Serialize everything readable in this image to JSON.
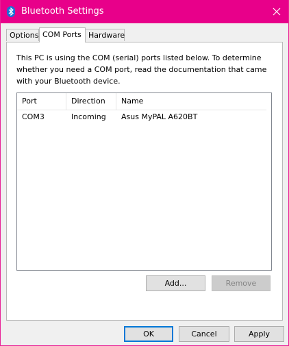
{
  "window": {
    "title": "Bluetooth Settings",
    "title_icon": "bluetooth-icon",
    "close_icon": "close-icon"
  },
  "tabs": [
    {
      "label": "Options",
      "active": false
    },
    {
      "label": "COM Ports",
      "active": true
    },
    {
      "label": "Hardware",
      "active": false
    }
  ],
  "panel": {
    "description": "This PC is using the COM (serial) ports listed below. To determine whether you need a COM port, read the documentation that came with your Bluetooth device.",
    "columns": [
      "Port",
      "Direction",
      "Name"
    ],
    "rows": [
      {
        "port": "COM3",
        "direction": "Incoming",
        "name": "Asus MyPAL A620BT"
      }
    ],
    "add_label": "Add...",
    "remove_label": "Remove"
  },
  "footer": {
    "ok_label": "OK",
    "cancel_label": "Cancel",
    "apply_label": "Apply"
  },
  "colors": {
    "titlebar": "#e8008a",
    "focus_accent": "#0078d7"
  }
}
